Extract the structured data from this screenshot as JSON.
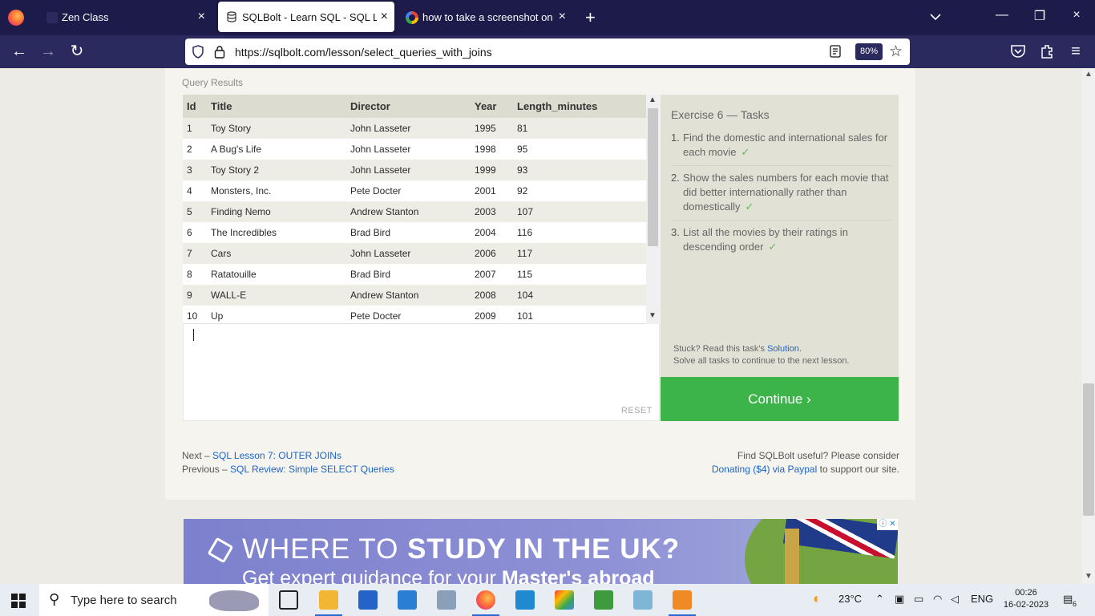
{
  "browser": {
    "tabs": [
      {
        "label": "Zen Class",
        "active": false
      },
      {
        "label": "SQLBolt - Learn SQL - SQL Lesso",
        "active": true
      },
      {
        "label": "how to take a screenshot on fire",
        "active": false
      }
    ],
    "url": "https://sqlbolt.com/lesson/select_queries_with_joins",
    "zoom": "80%",
    "icons": {
      "close": "×",
      "new_tab": "+",
      "back": "←",
      "forward": "→",
      "reload": "↻",
      "minimize": "—",
      "maximize": "❐",
      "star": "☆",
      "menu": "≡"
    }
  },
  "page": {
    "query_results_label": "Query Results",
    "results_table": {
      "columns": [
        "Id",
        "Title",
        "Director",
        "Year",
        "Length_minutes"
      ],
      "rows": [
        [
          "1",
          "Toy Story",
          "John Lasseter",
          "1995",
          "81"
        ],
        [
          "2",
          "A Bug's Life",
          "John Lasseter",
          "1998",
          "95"
        ],
        [
          "3",
          "Toy Story 2",
          "John Lasseter",
          "1999",
          "93"
        ],
        [
          "4",
          "Monsters, Inc.",
          "Pete Docter",
          "2001",
          "92"
        ],
        [
          "5",
          "Finding Nemo",
          "Andrew Stanton",
          "2003",
          "107"
        ],
        [
          "6",
          "The Incredibles",
          "Brad Bird",
          "2004",
          "116"
        ],
        [
          "7",
          "Cars",
          "John Lasseter",
          "2006",
          "117"
        ],
        [
          "8",
          "Ratatouille",
          "Brad Bird",
          "2007",
          "115"
        ],
        [
          "9",
          "WALL-E",
          "Andrew Stanton",
          "2008",
          "104"
        ],
        [
          "10",
          "Up",
          "Pete Docter",
          "2009",
          "101"
        ]
      ]
    },
    "editor": {
      "reset_label": "RESET"
    },
    "tasks": {
      "title": "Exercise 6 — Tasks",
      "items": [
        {
          "num": "1.",
          "text": "Find the domestic and international sales for each movie",
          "check": "✓"
        },
        {
          "num": "2.",
          "text": "Show the sales numbers for each movie that did better internationally rather than domestically",
          "check": "✓"
        },
        {
          "num": "3.",
          "text": "List all the movies by their ratings in descending order",
          "check": "✓"
        }
      ],
      "stuck_prefix": "Stuck? Read this task's",
      "solution_link": "Solution",
      "stuck_suffix": ".",
      "continue_hint": "Solve all tasks to continue to the next lesson."
    },
    "continue_button": "Continue ›",
    "footer": {
      "next_prefix": "Next –",
      "next_link": "SQL Lesson 7: OUTER JOINs",
      "prev_prefix": "Previous –",
      "prev_link": "SQL Review: Simple SELECT Queries",
      "useful_text": "Find SQLBolt useful? Please consider",
      "donate_link": "Donating ($4) via Paypal",
      "donate_suffix": "to support our site."
    },
    "ad": {
      "headline_plain": "WHERE TO",
      "headline_bold": "STUDY IN THE UK?",
      "subline_plain": "Get expert guidance for your",
      "subline_bold": "Master's abroad",
      "adchoice": "ⓘ ✕"
    }
  },
  "taskbar": {
    "search_placeholder": "Type here to search",
    "weather": "23°C",
    "language": "ENG",
    "time": "00:26",
    "date": "16-02-2023",
    "notifications": "6"
  }
}
